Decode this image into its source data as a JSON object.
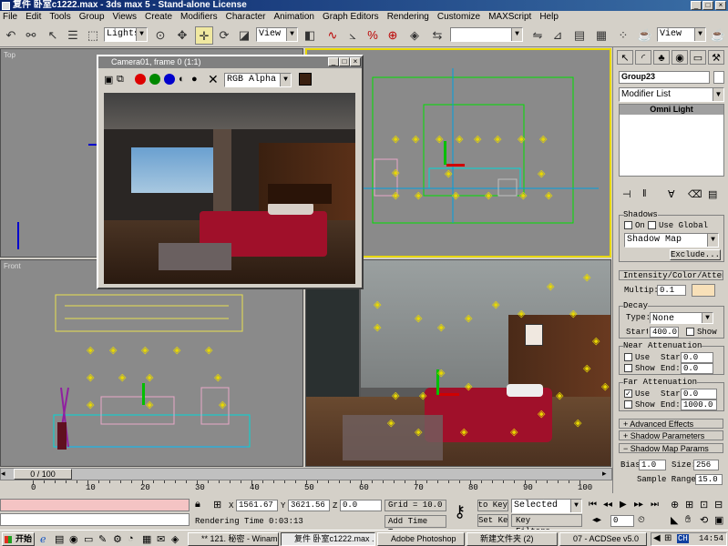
{
  "window": {
    "title": "复件 卧室c1222.max - 3ds max 5 - Stand-alone License"
  },
  "menu": [
    "File",
    "Edit",
    "Tools",
    "Group",
    "Views",
    "Create",
    "Modifiers",
    "Character",
    "Animation",
    "Graph Editors",
    "Rendering",
    "Customize",
    "MAXScript",
    "Help"
  ],
  "toolbar": {
    "selection_filter": "Lights",
    "ref_coord": "View",
    "named_sel": "",
    "render_type": "View"
  },
  "viewports": {
    "top": "Top",
    "front": "Front"
  },
  "camera_window": {
    "title": "Camera01, frame 0 (1:1)",
    "channel": "RGB Alpha"
  },
  "panel": {
    "object_name": "Group23",
    "modifier_list": "Modifier List",
    "stack_item": "Omni Light",
    "shadows": {
      "heading": "Shadows",
      "on": "On",
      "use_global": "Use Global",
      "type": "Shadow Map",
      "exclude": "Exclude..."
    },
    "intensity": {
      "heading": "Intensity/Color/Attenuation",
      "multiplier_label": "Multip:",
      "multiplier": "0.1"
    },
    "decay": {
      "heading": "Decay",
      "type_label": "Type:",
      "type": "None",
      "start_label": "Start:",
      "start": "400.0",
      "show": "Show"
    },
    "near": {
      "heading": "Near Attenuation",
      "use": "Use",
      "show": "Show",
      "start_label": "Start:",
      "start": "0.0",
      "end_label": "End:",
      "end": "0.0"
    },
    "far": {
      "heading": "Far Attenuation",
      "use": "Use",
      "show": "Show",
      "start_label": "Start:",
      "start": "0.0",
      "end_label": "End:",
      "end": "1000.0"
    },
    "rollouts": [
      "Advanced Effects",
      "Shadow Parameters",
      "Shadow Map Params"
    ],
    "bias_label": "Bias:",
    "bias": "1.0",
    "size_label": "Size:",
    "size": "256",
    "sample_label": "Sample Range:",
    "sample": "15.0"
  },
  "timeline": {
    "frame": "0 / 100"
  },
  "ruler": [
    "0",
    "10",
    "20",
    "30",
    "40",
    "50",
    "60",
    "70",
    "80",
    "90",
    "100"
  ],
  "status": {
    "x_label": "X",
    "x": "1561.67",
    "y_label": "Y",
    "y": "3621.56",
    "z_label": "Z",
    "z": "0.0",
    "grid": "Grid = 10.0",
    "auto_key": "Auto Key",
    "selected": "Selected",
    "set_key": "Set Key",
    "key_filters": "Key Filters...",
    "frame": "0",
    "render_time": "Rendering Time  0:03:13",
    "add_time_tag": "Add Time Tag"
  },
  "taskbar": {
    "start": "开始",
    "tasks": [
      "** 121. 秘密 - Winamp",
      "复件 卧室c1222.max ...",
      "Adobe Photoshop",
      "新建文件夹 (2)",
      "07 - ACDSee v5.0"
    ],
    "lang": "CH",
    "clock": "14:54"
  },
  "colors": {
    "title_gradient": "#0a246a",
    "viewport_bg": "#8a8a8a",
    "active_border": "#e8d800",
    "bed_red": "#a0102a"
  }
}
